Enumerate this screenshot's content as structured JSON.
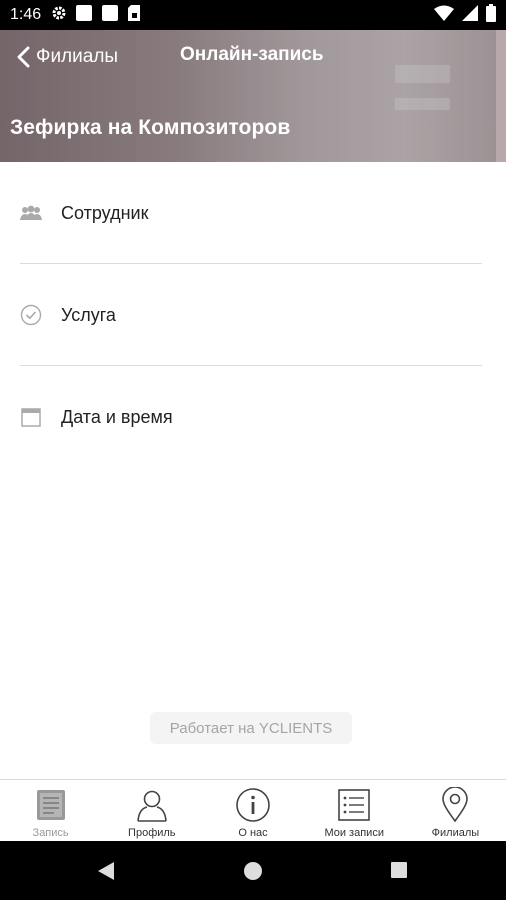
{
  "status_bar": {
    "time": "1:46"
  },
  "header": {
    "back_label": "Филиалы",
    "title": "Онлайн-запись",
    "branch_name": "Зефирка на Композиторов"
  },
  "booking_steps": [
    {
      "label": "Сотрудник",
      "icon": "people-icon"
    },
    {
      "label": "Услуга",
      "icon": "check-circle-icon"
    },
    {
      "label": "Дата и время",
      "icon": "calendar-icon"
    }
  ],
  "powered_by": "Работает на YCLIENTS",
  "tabs": [
    {
      "label": "Запись",
      "icon": "notebook-icon",
      "active": true
    },
    {
      "label": "Профиль",
      "icon": "user-icon",
      "active": false
    },
    {
      "label": "О нас",
      "icon": "info-icon",
      "active": false
    },
    {
      "label": "Мои записи",
      "icon": "list-icon",
      "active": false
    },
    {
      "label": "Филиалы",
      "icon": "location-pin-icon",
      "active": false
    }
  ],
  "colors": {
    "header_overlay": "#8d7d80",
    "text": "#222222",
    "muted": "#a5a5a5"
  }
}
